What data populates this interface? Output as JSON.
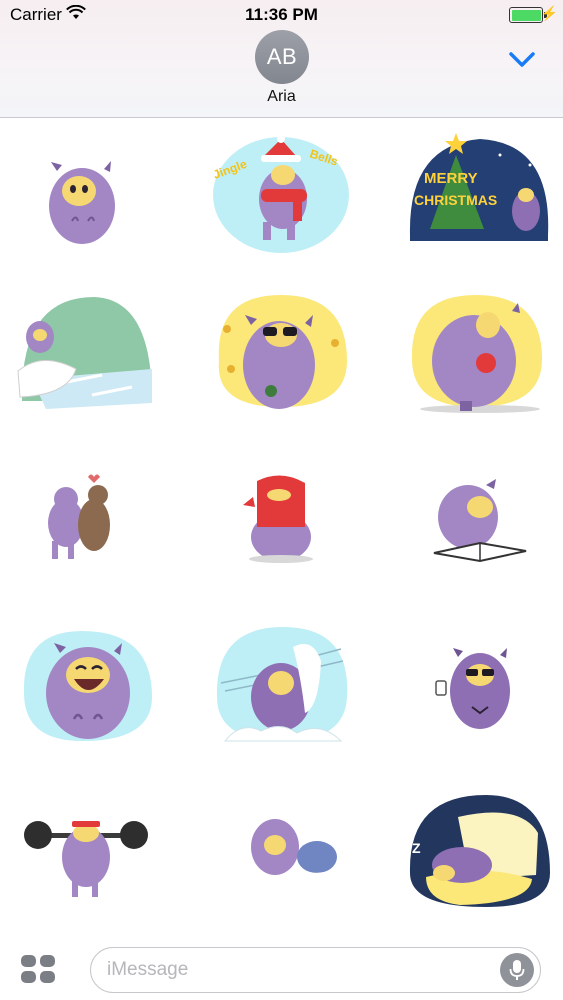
{
  "status_bar": {
    "carrier": "Carrier",
    "time": "11:36 PM",
    "battery_percent": 100,
    "wifi_icon": "wifi-icon",
    "charging_icon": "bolt-icon"
  },
  "header": {
    "avatar_initials": "AB",
    "contact_name": "Aria",
    "collapse_icon": "chevron-down-icon",
    "accent_color": "#1a7cf5"
  },
  "sticker_grid": {
    "stickers": [
      {
        "name": "llama-plain"
      },
      {
        "name": "llama-jingle-bells-scarf",
        "text": "Jingle Bells"
      },
      {
        "name": "llama-merry-christmas-tree",
        "text": "MERRY CHRISTMAS"
      },
      {
        "name": "llama-snow-sled"
      },
      {
        "name": "llama-sunglasses-coins"
      },
      {
        "name": "llama-gift-yellow"
      },
      {
        "name": "llama-hug-bear"
      },
      {
        "name": "llama-red-scarf"
      },
      {
        "name": "llama-reading-book"
      },
      {
        "name": "llama-laughing"
      },
      {
        "name": "llama-snowstorm"
      },
      {
        "name": "llama-sunglasses-drink"
      },
      {
        "name": "llama-weightlifting"
      },
      {
        "name": "llama-crawling"
      },
      {
        "name": "llama-sleeping-pillow",
        "text": "Z"
      }
    ]
  },
  "bottom_bar": {
    "apps_icon": "app-drawer-icon",
    "message_placeholder": "iMessage",
    "message_value": "",
    "mic_icon": "microphone-icon"
  }
}
